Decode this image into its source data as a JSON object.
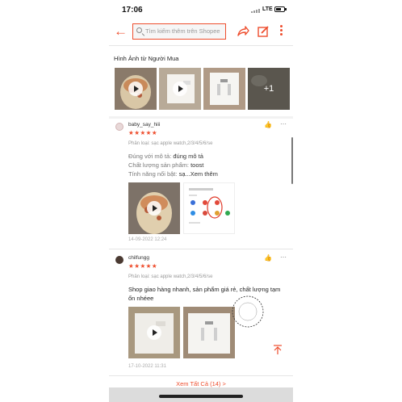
{
  "status": {
    "time": "17:06",
    "network": "LTE",
    "battery_percent": 70
  },
  "header": {
    "search_placeholder": "Tìm kiếm thêm trên Shopee",
    "icons": [
      "back-arrow-icon",
      "search-icon",
      "share-icon",
      "edit-icon",
      "more-vertical-icon"
    ],
    "accent": "#ee4d2d"
  },
  "buyer_photos": {
    "title": "Hình Ảnh từ Người Mua",
    "more_count": "+1"
  },
  "reviews": [
    {
      "username": "baby_say_hiii",
      "stars": "★★★★★",
      "variant": "Phân loại: sạc apple watch,2/3/4/5/6/se",
      "attrs": [
        {
          "key": "Đúng với mô tả:",
          "value": "đúng mô tả"
        },
        {
          "key": "Chất lượng sản phẩm:",
          "value": "toost"
        },
        {
          "key": "Tính năng nổi bật:",
          "value": "sạ...Xem thêm"
        }
      ],
      "date": "14-09-2022 12:24"
    },
    {
      "username": "chilfungg",
      "stars": "★★★★★",
      "variant": "Phân loại: sạc apple watch,2/3/4/5/6/se",
      "text": "Shop giao hàng nhanh, sản phẩm giá rẻ, chất lượng tạm ổn nhéee",
      "date": "17-10-2022 11:31"
    }
  ],
  "see_all": "Xem Tất Cả (14) >"
}
